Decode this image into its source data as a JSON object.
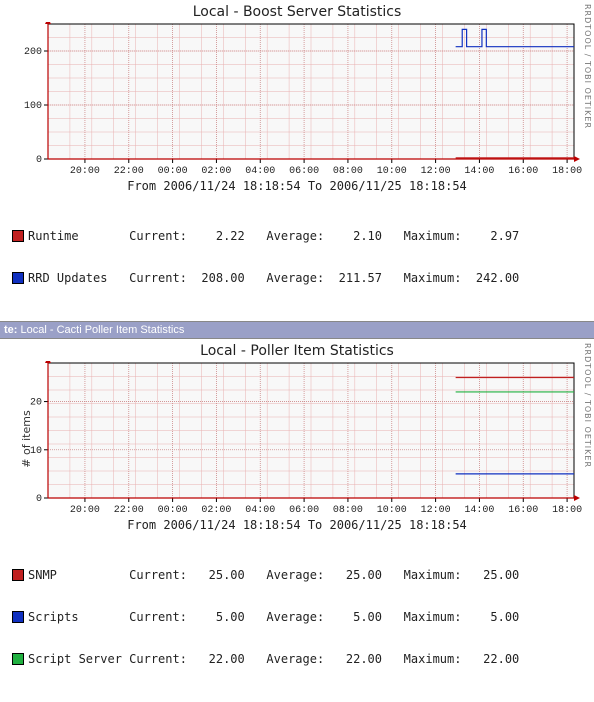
{
  "watermark": "RRDTOOL / TOBI OETIKER",
  "separator_label": "te:",
  "separator_text": "Local - Cacti Poller Item Statistics",
  "timespan": "From 2006/11/24 18:18:54 To 2006/11/25 18:18:54",
  "x_ticks": [
    "20:00",
    "22:00",
    "00:00",
    "02:00",
    "04:00",
    "06:00",
    "08:00",
    "10:00",
    "12:00",
    "14:00",
    "16:00",
    "18:00"
  ],
  "chart1": {
    "title": "Local - Boost Server Statistics",
    "y_ticks": [
      0,
      100,
      200
    ],
    "legend": {
      "runtime": {
        "label": "Runtime",
        "color": "#c02020",
        "current": "2.22",
        "average": "2.10",
        "maximum": "2.97"
      },
      "rrdupdates": {
        "label": "RRD Updates",
        "color": "#1030c0",
        "current": "208.00",
        "average": "211.57",
        "maximum": "242.00"
      }
    }
  },
  "chart2": {
    "title": "Local - Poller Item Statistics",
    "ylabel": "# of items",
    "y_ticks": [
      0,
      10,
      20
    ],
    "legend": {
      "snmp": {
        "label": "SNMP",
        "color": "#c02020",
        "current": "25.00",
        "average": "25.00",
        "maximum": "25.00"
      },
      "scripts": {
        "label": "Scripts",
        "color": "#1030c0",
        "current": "5.00",
        "average": "5.00",
        "maximum": "5.00"
      },
      "sserver": {
        "label": "Script Server",
        "color": "#20b040",
        "current": "22.00",
        "average": "22.00",
        "maximum": "22.00"
      }
    }
  },
  "chart_data": [
    {
      "type": "line",
      "title": "Local - Boost Server Statistics",
      "xlabel": "",
      "ylabel": "",
      "ylim": [
        0,
        250
      ],
      "x_range_hours": [
        "2006-11-24 18:18:54",
        "2006-11-25 18:18:54"
      ],
      "series": [
        {
          "name": "Runtime",
          "color": "#c02020",
          "segments": [
            {
              "from_h": 18.6,
              "to_h": 24.0,
              "value": 2.1
            }
          ]
        },
        {
          "name": "RRD Updates",
          "color": "#1030c0",
          "segments": [
            {
              "from_h": 18.6,
              "to_h": 18.9,
              "value": 208
            },
            {
              "from_h": 18.9,
              "to_h": 19.1,
              "value": 240
            },
            {
              "from_h": 19.1,
              "to_h": 19.8,
              "value": 208
            },
            {
              "from_h": 19.8,
              "to_h": 20.0,
              "value": 240
            },
            {
              "from_h": 20.0,
              "to_h": 24.0,
              "value": 208
            }
          ]
        }
      ]
    },
    {
      "type": "line",
      "title": "Local - Poller Item Statistics",
      "xlabel": "",
      "ylabel": "# of items",
      "ylim": [
        0,
        28
      ],
      "x_range_hours": [
        "2006-11-24 18:18:54",
        "2006-11-25 18:18:54"
      ],
      "series": [
        {
          "name": "SNMP",
          "color": "#c02020",
          "segments": [
            {
              "from_h": 18.6,
              "to_h": 24.0,
              "value": 25
            }
          ]
        },
        {
          "name": "Scripts",
          "color": "#1030c0",
          "segments": [
            {
              "from_h": 18.6,
              "to_h": 24.0,
              "value": 5
            }
          ]
        },
        {
          "name": "Script Server",
          "color": "#20b040",
          "segments": [
            {
              "from_h": 18.6,
              "to_h": 24.0,
              "value": 22
            }
          ]
        }
      ]
    }
  ]
}
